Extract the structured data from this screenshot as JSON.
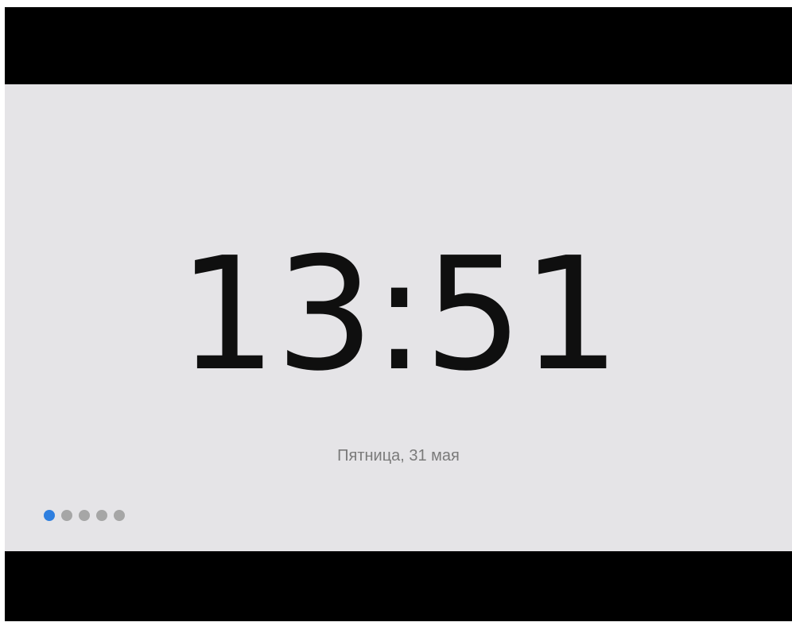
{
  "clock": {
    "time": "13:51",
    "date": "Пятница, 31 мая"
  },
  "pager": {
    "total_pages": 5,
    "current_page": 1,
    "active_color": "#2f7fdf",
    "inactive_color": "#a6a6a6"
  },
  "colors": {
    "screen_background": "#e5e4e7",
    "frame": "#000000",
    "time_text": "#0f0f0f",
    "date_text": "#7a7a7a"
  }
}
